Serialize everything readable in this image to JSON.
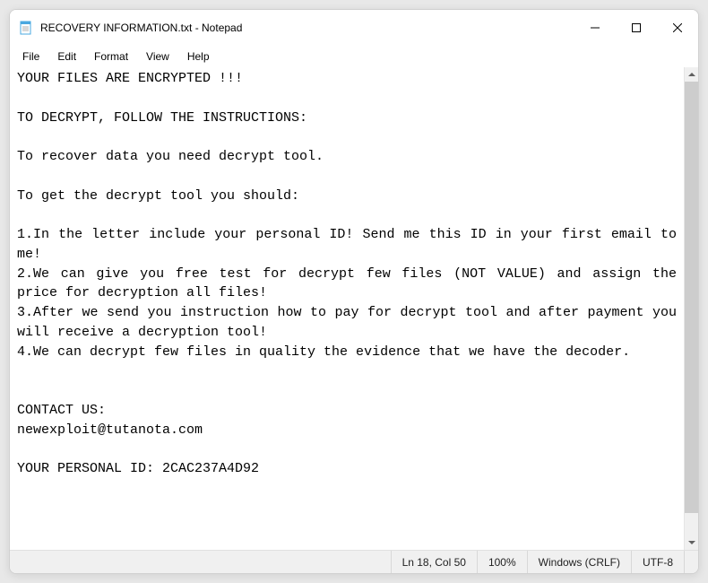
{
  "window": {
    "title": "RECOVERY INFORMATION.txt - Notepad"
  },
  "menu": {
    "file": "File",
    "edit": "Edit",
    "format": "Format",
    "view": "View",
    "help": "Help"
  },
  "content": {
    "text": "YOUR FILES ARE ENCRYPTED !!!\n\nTO DECRYPT, FOLLOW THE INSTRUCTIONS:\n\nTo recover data you need decrypt tool.\n\nTo get the decrypt tool you should:\n\n1.In the letter include your personal ID! Send me this ID in your first email to me!\n2.We can give you free test for decrypt few files (NOT VALUE) and assign the price for decryption all files!\n3.After we send you instruction how to pay for decrypt tool and after payment you will receive a decryption tool!\n4.We can decrypt few files in quality the evidence that we have the decoder.\n\n\nCONTACT US:\nnewexploit@tutanota.com\n\nYOUR PERSONAL ID: 2CAC237A4D92"
  },
  "status": {
    "position": "Ln 18, Col 50",
    "zoom": "100%",
    "line_ending": "Windows (CRLF)",
    "encoding": "UTF-8"
  }
}
